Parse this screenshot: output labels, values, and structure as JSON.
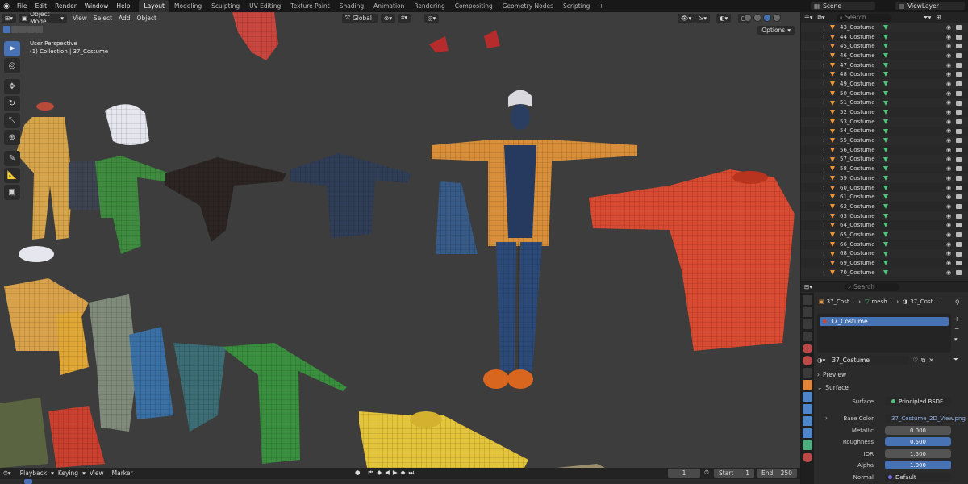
{
  "menu": [
    "File",
    "Edit",
    "Render",
    "Window",
    "Help"
  ],
  "workspaces": [
    "Layout",
    "Modeling",
    "Sculpting",
    "UV Editing",
    "Texture Paint",
    "Shading",
    "Animation",
    "Rendering",
    "Compositing",
    "Geometry Nodes",
    "Scripting"
  ],
  "active_workspace": "Layout",
  "scene": "Scene",
  "view_layer": "ViewLayer",
  "viewport": {
    "mode": "Object Mode",
    "menus": [
      "View",
      "Select",
      "Add",
      "Object"
    ],
    "transform_orientation": "Global",
    "info_line1": "User Perspective",
    "info_line2": "(1) Collection | 37_Costume",
    "options_label": "Options"
  },
  "timeline": {
    "items": [
      "Playback",
      "Keying",
      "View",
      "Marker"
    ],
    "current_frame": "1",
    "start_label": "Start",
    "start_value": "1",
    "end_label": "End",
    "end_value": "250"
  },
  "outliner": {
    "search_placeholder": "Search",
    "items": [
      "43_Costume",
      "44_Costume",
      "45_Costume",
      "46_Costume",
      "47_Costume",
      "48_Costume",
      "49_Costume",
      "50_Costume",
      "51_Costume",
      "52_Costume",
      "53_Costume",
      "54_Costume",
      "55_Costume",
      "56_Costume",
      "57_Costume",
      "58_Costume",
      "59_Costume",
      "60_Costume",
      "61_Costume",
      "62_Costume",
      "63_Costume",
      "64_Costume",
      "65_Costume",
      "66_Costume",
      "68_Costume",
      "69_Costume",
      "70_Costume"
    ]
  },
  "properties": {
    "search_placeholder": "Search",
    "breadcrumb": [
      "37_Cost...",
      "mesh...",
      "37_Cost..."
    ],
    "slot": "37_Costume",
    "material": "37_Costume",
    "preview_label": "Preview",
    "surface_section": "Surface",
    "surface_label": "Surface",
    "surface_value": "Principled BSDF",
    "base_color_label": "Base Color",
    "base_color_value": "37_Costume_2D_View.png",
    "metallic_label": "Metallic",
    "metallic_value": "0.000",
    "roughness_label": "Roughness",
    "roughness_value": "0.500",
    "ior_label": "IOR",
    "ior_value": "1.500",
    "alpha_label": "Alpha",
    "alpha_value": "1.000",
    "normal_label": "Normal",
    "normal_value": "Default"
  },
  "colors": {
    "accent": "#4772b3",
    "object_orange": "#e8963a",
    "modifier_green": "#4fc27c"
  }
}
